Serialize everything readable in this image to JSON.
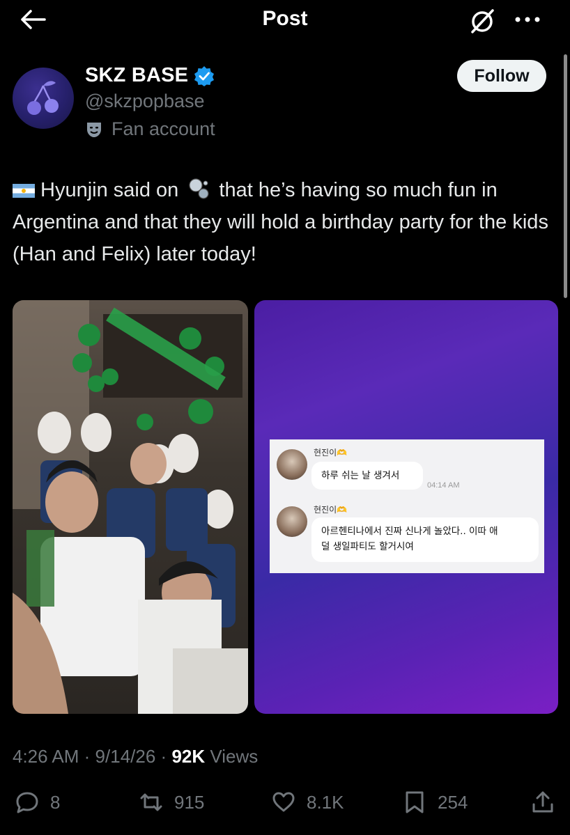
{
  "header": {
    "title": "Post"
  },
  "author": {
    "name": "SKZ BASE",
    "handle": "@skzpopbase",
    "label": "Fan account",
    "follow_label": "Follow"
  },
  "tweet": {
    "part1": "Hyunjin said on",
    "part2": "that he’s having so much fun in Argentina and that they will hold a birthday party for the kids (Han and Felix) later today!"
  },
  "media": {
    "chat": {
      "msg1_name": "현진이🫶",
      "msg1_text": "하루 쉬는 날 생겨서",
      "msg1_time": "04:14 AM",
      "msg2_name": "현진이🫶",
      "msg2_text_line1": "아르헨티나에서 진짜 신나게 놀았다.. 이따 애",
      "msg2_text_line2": "덜 생일파티도 할거시여"
    }
  },
  "meta": {
    "time": "4:26 AM",
    "sep1": "·",
    "date": "9/14/26",
    "sep2": "·",
    "views_count": "92K",
    "views_label": "Views"
  },
  "actions": {
    "replies": "8",
    "reposts": "915",
    "likes": "8.1K",
    "bookmarks": "254"
  }
}
